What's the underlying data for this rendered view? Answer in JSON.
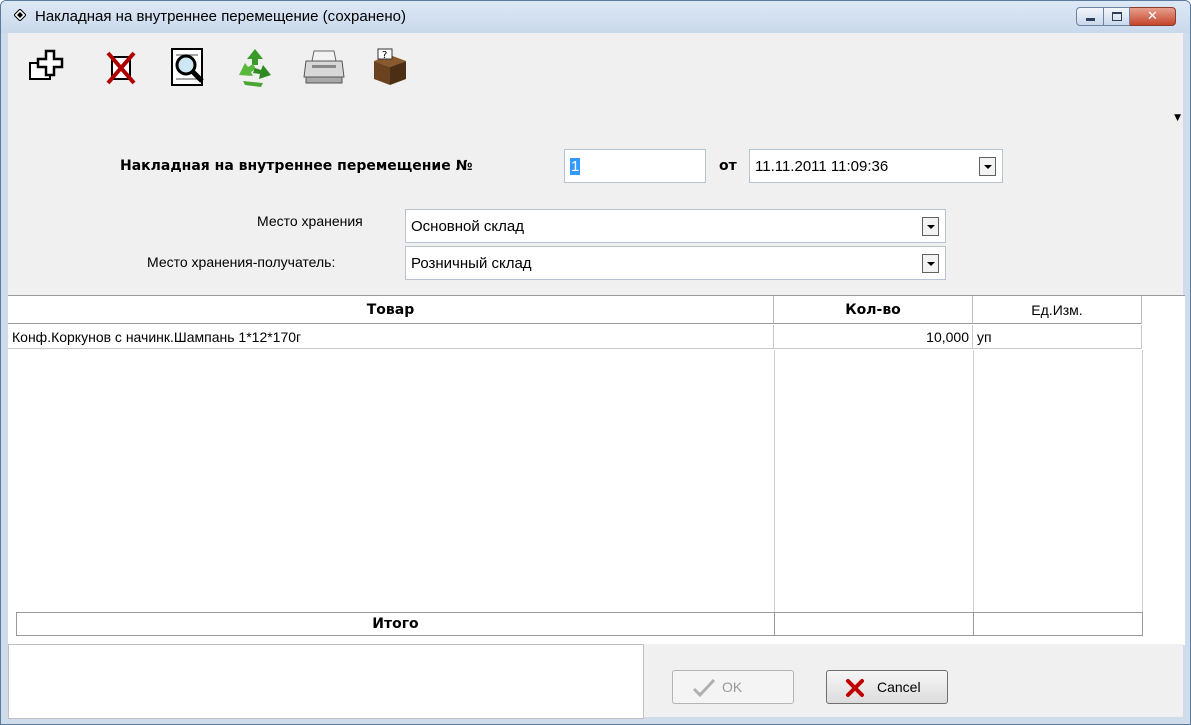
{
  "window": {
    "title": "Накладная на внутреннее перемещение (сохранено)",
    "controls": [
      "minimize",
      "maximize",
      "close"
    ]
  },
  "toolbar": {
    "icons": [
      "add-document-icon",
      "delete-icon",
      "preview-icon",
      "recycle-icon",
      "printer-icon",
      "box-help-icon"
    ]
  },
  "header": {
    "doc_label": "Накладная  на внутреннее перемещение №",
    "doc_number": "1",
    "date_label": "от",
    "date_value": "11.11.2011 11:09:36"
  },
  "storage": {
    "source_label": "Место хранения",
    "source_value": "Основной склад",
    "target_label": "Место хранения-получатель:",
    "target_value": "Розничный склад"
  },
  "table": {
    "columns": [
      "Товар",
      "Кол-во",
      "Ед.Изм."
    ],
    "rows": [
      {
        "product": "Конф.Коркунов с начинк.Шампань 1*12*170г",
        "qty": "10,000",
        "unit": "уп"
      }
    ],
    "total_label": "Итого"
  },
  "buttons": {
    "ok_label": "OK",
    "cancel_label": "Cancel"
  },
  "colors": {
    "titlebar": "#c9d9ec",
    "close_button": "#c4452c",
    "selection": "#3399ff"
  }
}
